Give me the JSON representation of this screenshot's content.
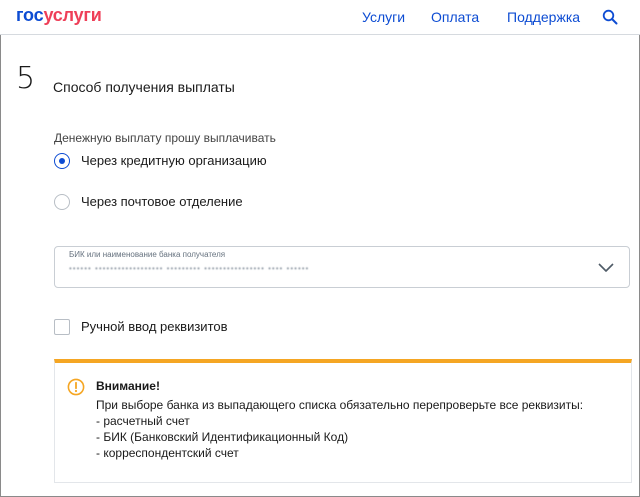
{
  "header": {
    "logo_part1": "гос",
    "logo_part2": "услуги",
    "nav": [
      {
        "label": "Услуги"
      },
      {
        "label": "Оплата"
      },
      {
        "label": "Поддержка"
      }
    ],
    "search_icon": "search-icon"
  },
  "section": {
    "step_number": "5",
    "title": "Способ получения выплаты"
  },
  "payment_method": {
    "label": "Денежную выплату прошу выплачивать",
    "options": [
      {
        "label": "Через кредитную организацию",
        "selected": true
      },
      {
        "label": "Через почтовое отделение",
        "selected": false
      }
    ]
  },
  "bank_select": {
    "label": "БИК или наименование банка получателя",
    "value": "•••••• •••••••••••••••••• ••••••••• •••••••••••••••• •••• ••••••"
  },
  "manual_entry": {
    "label": "Ручной ввод реквизитов",
    "checked": false
  },
  "warning": {
    "title": "Внимание!",
    "lines": [
      "При выборе банка из выпадающего списка обязательно перепроверьте все реквизиты:",
      "- расчетный счет",
      "- БИК (Банковский Идентификационный Код)",
      "- корреспондентский счет"
    ],
    "accent_color": "#f5a623"
  },
  "colors": {
    "brand_blue": "#0d4cd3",
    "brand_red": "#ee3f58",
    "warning_orange": "#f5a623"
  }
}
